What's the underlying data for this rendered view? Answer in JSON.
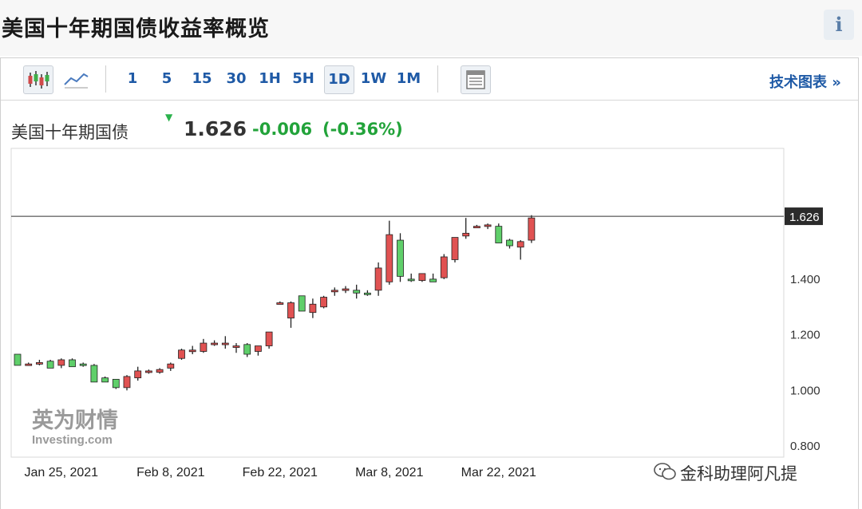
{
  "page": {
    "title": "美国十年期国债收益率概览",
    "info_icon": "i"
  },
  "toolbar": {
    "chart_types": [
      "candlestick-icon",
      "line-chart-icon"
    ],
    "timeframes": [
      {
        "label": "1",
        "active": false
      },
      {
        "label": "5",
        "active": false
      },
      {
        "label": "15",
        "active": false
      },
      {
        "label": "30",
        "active": false
      },
      {
        "label": "1H",
        "active": false
      },
      {
        "label": "5H",
        "active": false
      },
      {
        "label": "1D",
        "active": true
      },
      {
        "label": "1W",
        "active": false
      },
      {
        "label": "1M",
        "active": false
      }
    ],
    "tech_chart_link": "技术图表 »"
  },
  "quote": {
    "name": "美国十年期国债",
    "price": "1.626",
    "change": "-0.006",
    "change_pct": "(-0.36%)"
  },
  "watermark": {
    "cn": "英为财情",
    "en": "Investing.com"
  },
  "credit": "金科助理阿凡提",
  "colors": {
    "up": "#e05252",
    "down": "#5fcf6a",
    "accent": "#1f5aa6",
    "positive_text": "#22a33a"
  },
  "chart_data": {
    "type": "candlestick",
    "title": "",
    "xlabel": "",
    "ylabel": "",
    "ylim": [
      0.76,
      1.87
    ],
    "y_ticks": [
      "0.800",
      "1.000",
      "1.200",
      "1.400"
    ],
    "x_ticks": [
      {
        "label": "Jan 25, 2021",
        "index": 4
      },
      {
        "label": "Feb 8, 2021",
        "index": 14
      },
      {
        "label": "Feb 22, 2021",
        "index": 24
      },
      {
        "label": "Mar 8, 2021",
        "index": 34
      },
      {
        "label": "Mar 22, 2021",
        "index": 44
      }
    ],
    "last_price": 1.626,
    "last_price_label": "1.626",
    "grid": false,
    "candles": [
      [
        1.13,
        1.13,
        1.09,
        1.09
      ],
      [
        1.095,
        1.1,
        1.09,
        1.095
      ],
      [
        1.1,
        1.11,
        1.09,
        1.1
      ],
      [
        1.105,
        1.11,
        1.08,
        1.08
      ],
      [
        1.09,
        1.115,
        1.08,
        1.11
      ],
      [
        1.11,
        1.115,
        1.085,
        1.085
      ],
      [
        1.095,
        1.1,
        1.085,
        1.09
      ],
      [
        1.09,
        1.095,
        1.03,
        1.03
      ],
      [
        1.045,
        1.05,
        1.03,
        1.03
      ],
      [
        1.04,
        1.04,
        1.005,
        1.01
      ],
      [
        1.01,
        1.055,
        1.0,
        1.05
      ],
      [
        1.045,
        1.085,
        1.035,
        1.07
      ],
      [
        1.07,
        1.075,
        1.06,
        1.07
      ],
      [
        1.065,
        1.08,
        1.06,
        1.075
      ],
      [
        1.08,
        1.1,
        1.07,
        1.095
      ],
      [
        1.115,
        1.15,
        1.11,
        1.145
      ],
      [
        1.14,
        1.16,
        1.13,
        1.145
      ],
      [
        1.14,
        1.185,
        1.135,
        1.17
      ],
      [
        1.17,
        1.18,
        1.16,
        1.17
      ],
      [
        1.17,
        1.195,
        1.15,
        1.17
      ],
      [
        1.16,
        1.17,
        1.135,
        1.16
      ],
      [
        1.165,
        1.17,
        1.12,
        1.13
      ],
      [
        1.14,
        1.16,
        1.125,
        1.16
      ],
      [
        1.16,
        1.21,
        1.15,
        1.21
      ],
      [
        1.315,
        1.32,
        1.31,
        1.315
      ],
      [
        1.26,
        1.32,
        1.225,
        1.315
      ],
      [
        1.34,
        1.34,
        1.285,
        1.285
      ],
      [
        1.28,
        1.33,
        1.26,
        1.31
      ],
      [
        1.3,
        1.34,
        1.295,
        1.335
      ],
      [
        1.36,
        1.37,
        1.34,
        1.36
      ],
      [
        1.365,
        1.375,
        1.35,
        1.365
      ],
      [
        1.36,
        1.38,
        1.33,
        1.35
      ],
      [
        1.35,
        1.36,
        1.34,
        1.345
      ],
      [
        1.36,
        1.46,
        1.34,
        1.44
      ],
      [
        1.39,
        1.61,
        1.38,
        1.56
      ],
      [
        1.54,
        1.565,
        1.39,
        1.41
      ],
      [
        1.4,
        1.42,
        1.39,
        1.395
      ],
      [
        1.395,
        1.42,
        1.39,
        1.42
      ],
      [
        1.4,
        1.42,
        1.39,
        1.39
      ],
      [
        1.405,
        1.49,
        1.4,
        1.48
      ],
      [
        1.47,
        1.52,
        1.46,
        1.55
      ],
      [
        1.555,
        1.62,
        1.545,
        1.565
      ],
      [
        1.59,
        1.595,
        1.585,
        1.59
      ],
      [
        1.59,
        1.6,
        1.58,
        1.595
      ],
      [
        1.59,
        1.6,
        1.56,
        1.53
      ],
      [
        1.54,
        1.545,
        1.51,
        1.52
      ],
      [
        1.515,
        1.54,
        1.47,
        1.535
      ],
      [
        1.54,
        1.63,
        1.53,
        1.62
      ]
    ]
  }
}
